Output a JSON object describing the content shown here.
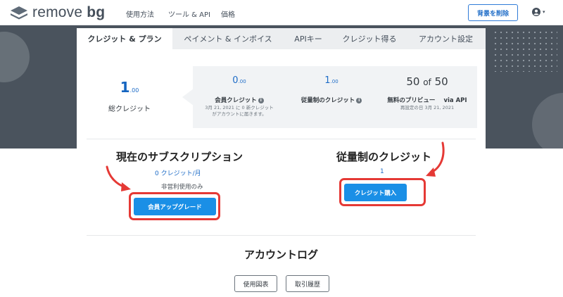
{
  "nav": {
    "logo_part1": "remove",
    "logo_part2": "bg",
    "links": [
      "使用方法",
      "ツール & API",
      "価格"
    ],
    "remove_bg_button": "背景を削除",
    "user_caret": "▾"
  },
  "tabs": [
    "クレジット & プラン",
    "ペイメント & インボイス",
    "APIキー",
    "クレジット得る",
    "アカウント設定"
  ],
  "credits": {
    "total_value": "1",
    "total_decimal": ".00",
    "total_label": "総クレジット",
    "member": {
      "value": "0",
      "decimal": ".00",
      "label": "会員クレジット",
      "sub_line1": "3月 21, 2021 に 0 新クレジット",
      "sub_line2": "がアカウントに届きます。"
    },
    "payg": {
      "value": "1",
      "decimal": ".00",
      "label": "従量制のクレジット"
    },
    "preview": {
      "used": "50",
      "of": "of",
      "total": "50",
      "label": "無料のプリビュー",
      "via": "via API",
      "sub": "再設定の日 3月 21, 2021"
    },
    "info_icon": "i"
  },
  "subscription": {
    "title": "現在のサブスクリプション",
    "rate": "0 クレジット/月",
    "note": "非営利使用のみ",
    "button": "会員アップグレード"
  },
  "payg_section": {
    "title": "従量制のクレジット",
    "count": "1",
    "button": "クレジット購入"
  },
  "log": {
    "title": "アカウントログ",
    "buttons": [
      "使用図表",
      "取引履歴"
    ]
  },
  "colors": {
    "accent": "#1a8fe6",
    "annotation_red": "#e53935",
    "hero_bg": "#4a535d"
  }
}
